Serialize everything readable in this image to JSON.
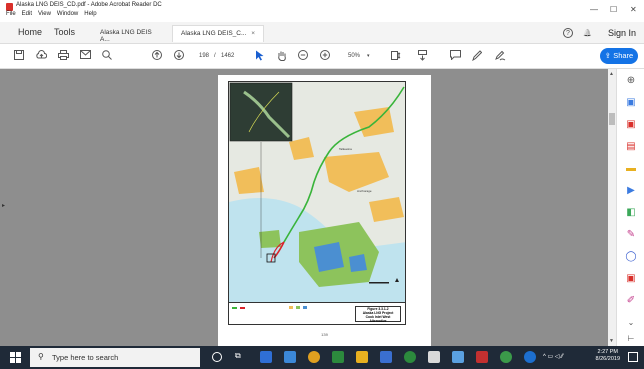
{
  "window": {
    "title": "Alaska LNG DEIS_CD.pdf - Adobe Acrobat Reader DC",
    "menu": [
      "File",
      "Edit",
      "View",
      "Window",
      "Help"
    ],
    "controls": {
      "minimize": "—",
      "maximize": "☐",
      "close": "✕"
    }
  },
  "tabs": {
    "home": "Home",
    "tools": "Tools",
    "docs": [
      {
        "label": "Alaska LNG DEIS A..."
      },
      {
        "label": "Alaska LNG DEIS_C...",
        "close": "×"
      }
    ],
    "help_icon": "?",
    "bell_icon": "🔔",
    "signin": "Sign In"
  },
  "toolbar": {
    "page_current": "198",
    "page_separator": "/",
    "page_total": "1462",
    "zoom": "50%",
    "share_label": "Share"
  },
  "document": {
    "page_number": "139",
    "map": {
      "labels": [
        "Talkeetna",
        "Anchorage"
      ]
    },
    "figure_caption": [
      "Figure 3.3.1-2",
      "Alaska LNG Project",
      "Cook Inlet West",
      "Alternative"
    ]
  },
  "taskbar": {
    "search_placeholder": "Type here to search",
    "time": "2:27 PM",
    "date": "8/26/2019",
    "app_colors": [
      "#2f6fd6",
      "#3b88d8",
      "#e0a020",
      "#2c8a3d",
      "#3a6fd0",
      "#d9d9d9",
      "#5aa0e0",
      "#e4572e",
      "#c23030",
      "#3b9a4a",
      "#1d6fcf"
    ]
  },
  "colors": {
    "accent": "#1473e6",
    "viewer_bg": "#8e8e8e",
    "taskbar": "#1f2a38"
  }
}
